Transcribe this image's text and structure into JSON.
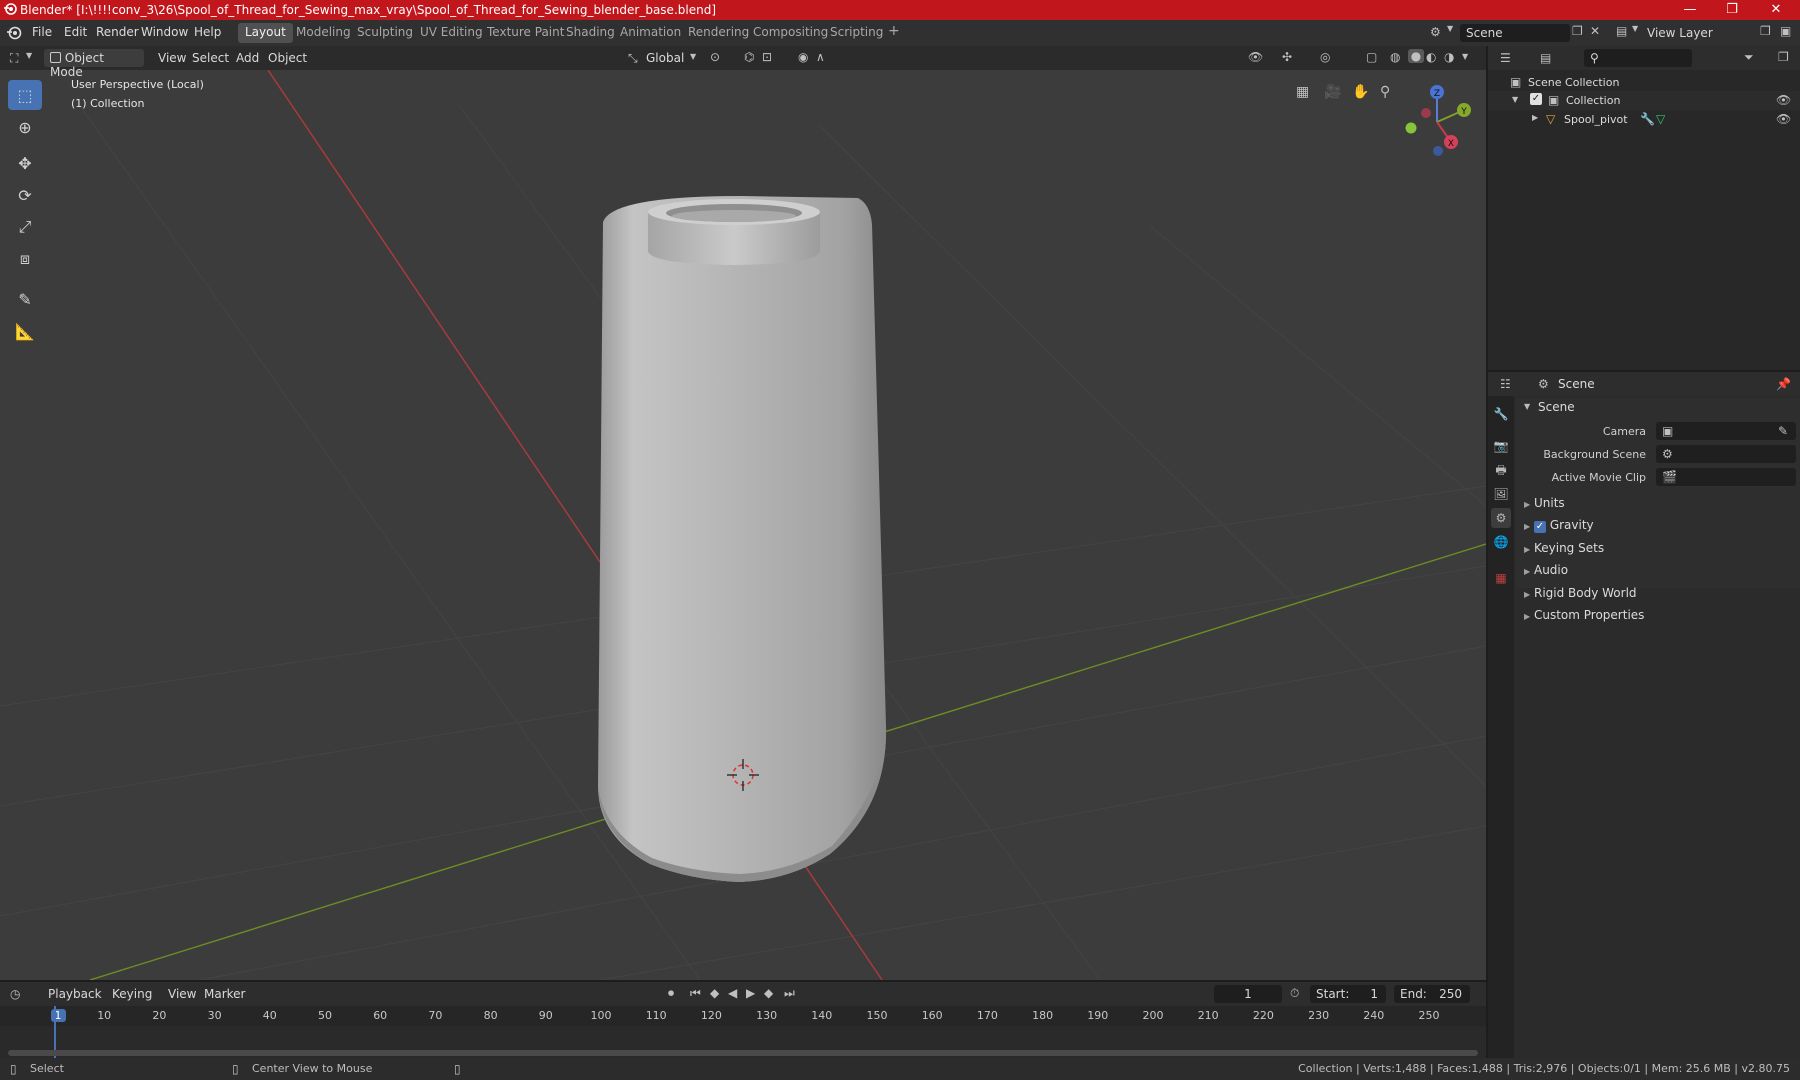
{
  "window": {
    "title": "Blender* [I:\\!!!!conv_3\\26\\Spool_of_Thread_for_Sewing_max_vray\\Spool_of_Thread_for_Sewing_blender_base.blend]",
    "minimize": "—",
    "maximize": "❐",
    "close": "✕"
  },
  "menus": [
    "File",
    "Edit",
    "Render",
    "Window",
    "Help"
  ],
  "workspaces": [
    "Layout",
    "Modeling",
    "Sculpting",
    "UV Editing",
    "Texture Paint",
    "Shading",
    "Animation",
    "Rendering",
    "Compositing",
    "Scripting"
  ],
  "add_workspace": "+",
  "scene_selector": "Scene",
  "view_layer_selector": "View Layer",
  "viewport": {
    "mode": "Object Mode",
    "menus": [
      "View",
      "Select",
      "Add",
      "Object"
    ],
    "transform_orientation": "Global",
    "perspective_label": "User Perspective (Local)",
    "collection_label": "(1) Collection",
    "gizmo_axes": {
      "x": "X",
      "y": "Y",
      "z": "Z"
    }
  },
  "outliner": {
    "search_placeholder": "",
    "rows": [
      {
        "label": "Scene Collection"
      },
      {
        "label": "Collection"
      },
      {
        "label": "Spool_pivot"
      }
    ]
  },
  "properties": {
    "header": "Scene",
    "panel_title": "Scene",
    "fields": [
      {
        "label": "Camera"
      },
      {
        "label": "Background Scene"
      },
      {
        "label": "Active Movie Clip"
      }
    ],
    "subpanels": [
      "Units",
      "Gravity",
      "Keying Sets",
      "Audio",
      "Rigid Body World",
      "Custom Properties"
    ],
    "gravity_checked": true
  },
  "timeline": {
    "menus": [
      "Playback",
      "Keying",
      "View",
      "Marker"
    ],
    "current_frame": "1",
    "start_label": "Start:",
    "start_value": "1",
    "end_label": "End:",
    "end_value": "250",
    "ruler": [
      "1",
      "10",
      "20",
      "30",
      "40",
      "50",
      "60",
      "70",
      "80",
      "90",
      "100",
      "110",
      "120",
      "130",
      "140",
      "150",
      "160",
      "170",
      "180",
      "190",
      "200",
      "210",
      "220",
      "230",
      "240",
      "250"
    ]
  },
  "statusbar": {
    "select": "Select",
    "center_view": "Center View to Mouse",
    "stats": "Collection | Verts:1,488 | Faces:1,488 | Tris:2,976 | Objects:0/1 | Mem: 25.6 MB | v2.80.75"
  },
  "colors": {
    "titlebar": "#c2161d",
    "accent": "#4772b3",
    "x_axis": "#b03a3a",
    "y_axis": "#6b8e23",
    "viewport_bg": "#3c3c3c"
  }
}
